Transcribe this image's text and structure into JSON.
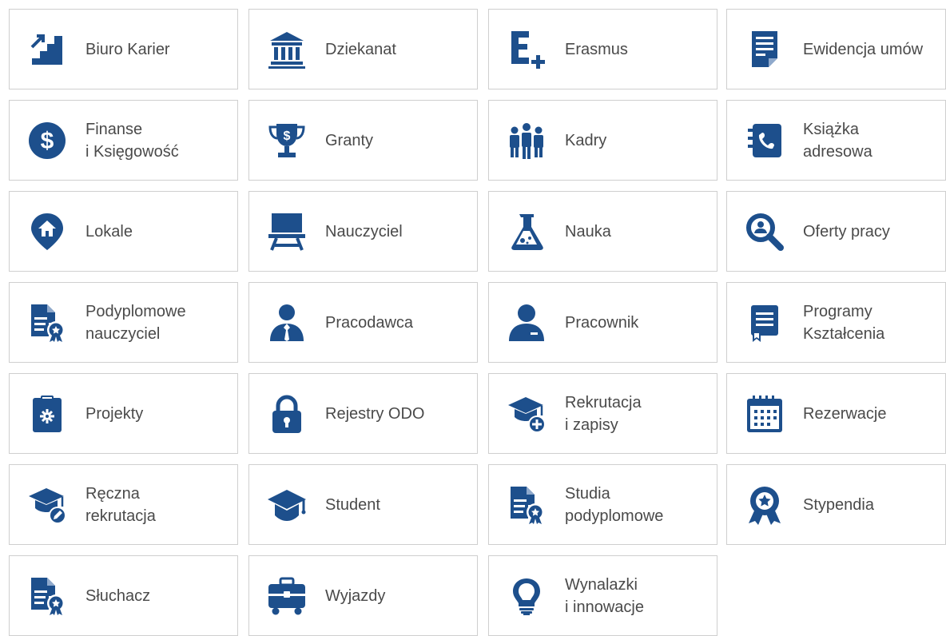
{
  "accent_color": "#1d4f8c",
  "tiles": [
    {
      "label": "Biuro Karier",
      "icon": "career-stairs-icon"
    },
    {
      "label": "Dziekanat",
      "icon": "institution-icon"
    },
    {
      "label": "Erasmus",
      "icon": "erasmus-plus-icon"
    },
    {
      "label": "Ewidencja umów",
      "icon": "document-list-icon"
    },
    {
      "label": "Finanse\ni Księgowość",
      "icon": "dollar-circle-icon"
    },
    {
      "label": "Granty",
      "icon": "trophy-dollar-icon"
    },
    {
      "label": "Kadry",
      "icon": "people-group-icon"
    },
    {
      "label": "Książka\nadresowa",
      "icon": "address-book-phone-icon"
    },
    {
      "label": "Lokale",
      "icon": "location-home-icon"
    },
    {
      "label": "Nauczyciel",
      "icon": "easel-board-icon"
    },
    {
      "label": "Nauka",
      "icon": "flask-icon"
    },
    {
      "label": "Oferty pracy",
      "icon": "search-person-icon"
    },
    {
      "label": "Podyplomowe\nnauczyciel",
      "icon": "certificate-document-icon"
    },
    {
      "label": "Pracodawca",
      "icon": "user-tie-icon"
    },
    {
      "label": "Pracownik",
      "icon": "user-icon"
    },
    {
      "label": "Programy\nKształcenia",
      "icon": "bookmark-document-icon"
    },
    {
      "label": "Projekty",
      "icon": "clipboard-gear-icon"
    },
    {
      "label": "Rejestry ODO",
      "icon": "padlock-icon"
    },
    {
      "label": "Rekrutacja\ni zapisy",
      "icon": "graduation-cap-plus-icon"
    },
    {
      "label": "Rezerwacje",
      "icon": "calendar-icon"
    },
    {
      "label": "Ręczna\nrekrutacja",
      "icon": "graduation-cap-edit-icon"
    },
    {
      "label": "Student",
      "icon": "graduation-cap-icon"
    },
    {
      "label": "Studia\npodyplomowe",
      "icon": "certificate-document-icon"
    },
    {
      "label": "Stypendia",
      "icon": "award-ribbon-icon"
    },
    {
      "label": "Słuchacz",
      "icon": "certificate-document-icon"
    },
    {
      "label": "Wyjazdy",
      "icon": "briefcase-icon"
    },
    {
      "label": "Wynalazki\ni innowacje",
      "icon": "lightbulb-icon"
    }
  ]
}
